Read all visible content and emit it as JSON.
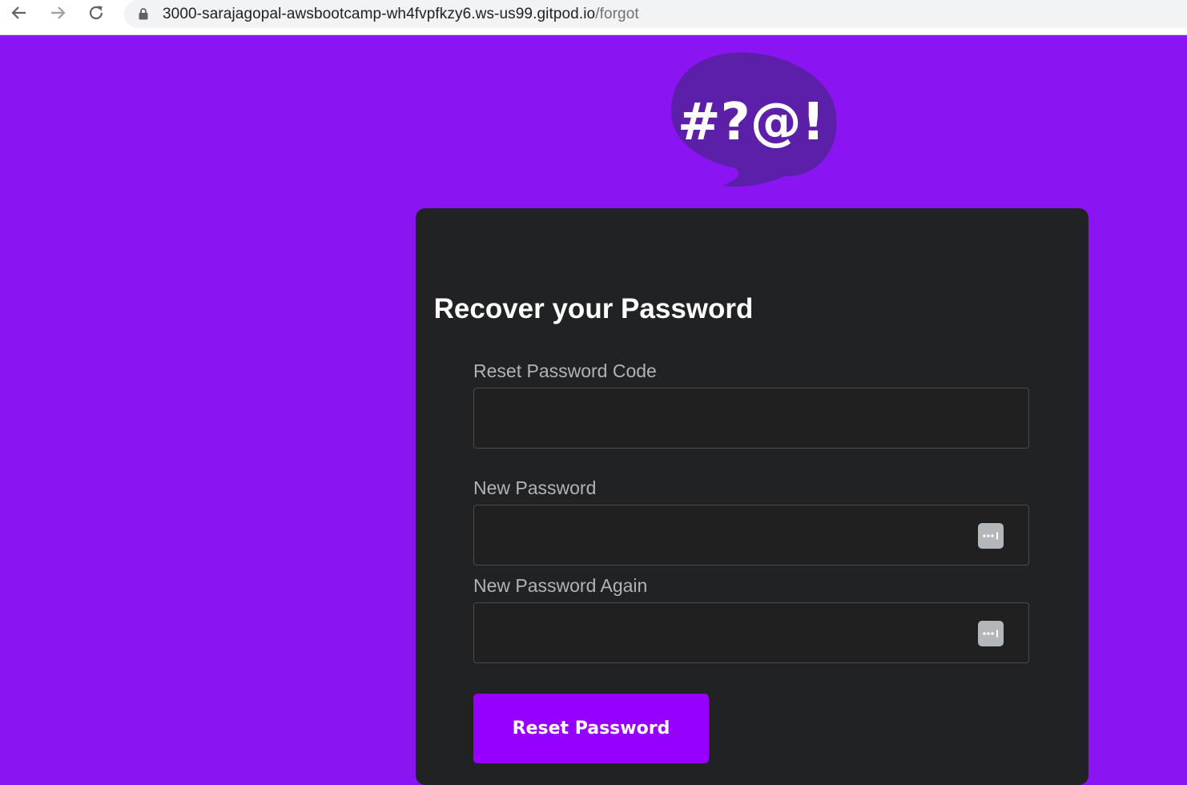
{
  "browser": {
    "url_host": "3000-sarajagopal-awsbootcamp-wh4fvpfkzy6.ws-us99.gitpod.io",
    "url_path": "/forgot",
    "icons": [
      "back-arrow-icon",
      "forward-arrow-icon",
      "reload-icon",
      "lock-icon"
    ]
  },
  "logo": {
    "text": "#?@!",
    "bubble_color": "#5c1fa8"
  },
  "form": {
    "title": "Recover your Password",
    "code_label": "Reset Password Code",
    "password_label": "New Password",
    "password_again_label": "New Password Again",
    "submit_label": "Reset Password"
  },
  "colors": {
    "page_background": "#8a15f2",
    "card_background": "#212224",
    "button_background": "#9500ff"
  }
}
